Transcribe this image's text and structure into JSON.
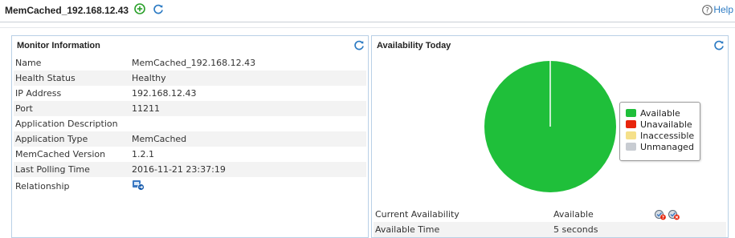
{
  "header": {
    "title": "MemCached_192.168.12.43",
    "help_label": "Help"
  },
  "monitor_info": {
    "title": "Monitor Information",
    "rows": [
      {
        "label": "Name",
        "value": "MemCached_192.168.12.43"
      },
      {
        "label": "Health Status",
        "value": "Healthy"
      },
      {
        "label": "IP Address",
        "value": "192.168.12.43"
      },
      {
        "label": "Port",
        "value": "11211"
      },
      {
        "label": "Application Description",
        "value": ""
      },
      {
        "label": "Application Type",
        "value": "MemCached"
      },
      {
        "label": "MemCached Version",
        "value": "1.2.1"
      },
      {
        "label": "Last Polling Time",
        "value": "2016-11-21 23:37:19"
      },
      {
        "label": "Relationship",
        "value": ""
      }
    ]
  },
  "availability": {
    "title": "Availability Today",
    "legend": [
      {
        "label": "Available",
        "color": "#1fbf3a"
      },
      {
        "label": "Unavailable",
        "color": "#e8250c"
      },
      {
        "label": "Inaccessible",
        "color": "#f5e08a"
      },
      {
        "label": "Unmanaged",
        "color": "#c8ccd2"
      }
    ],
    "rows": [
      {
        "label": "Current Availability",
        "value": "Available"
      },
      {
        "label": "Available Time",
        "value": "5 seconds"
      }
    ]
  },
  "chart_data": {
    "type": "pie",
    "title": "",
    "categories": [
      "Available",
      "Unavailable",
      "Inaccessible",
      "Unmanaged"
    ],
    "values": [
      100,
      0,
      0,
      0
    ],
    "colors": [
      "#1fbf3a",
      "#e8250c",
      "#f5e08a",
      "#c8ccd2"
    ],
    "legend_position": "right"
  }
}
